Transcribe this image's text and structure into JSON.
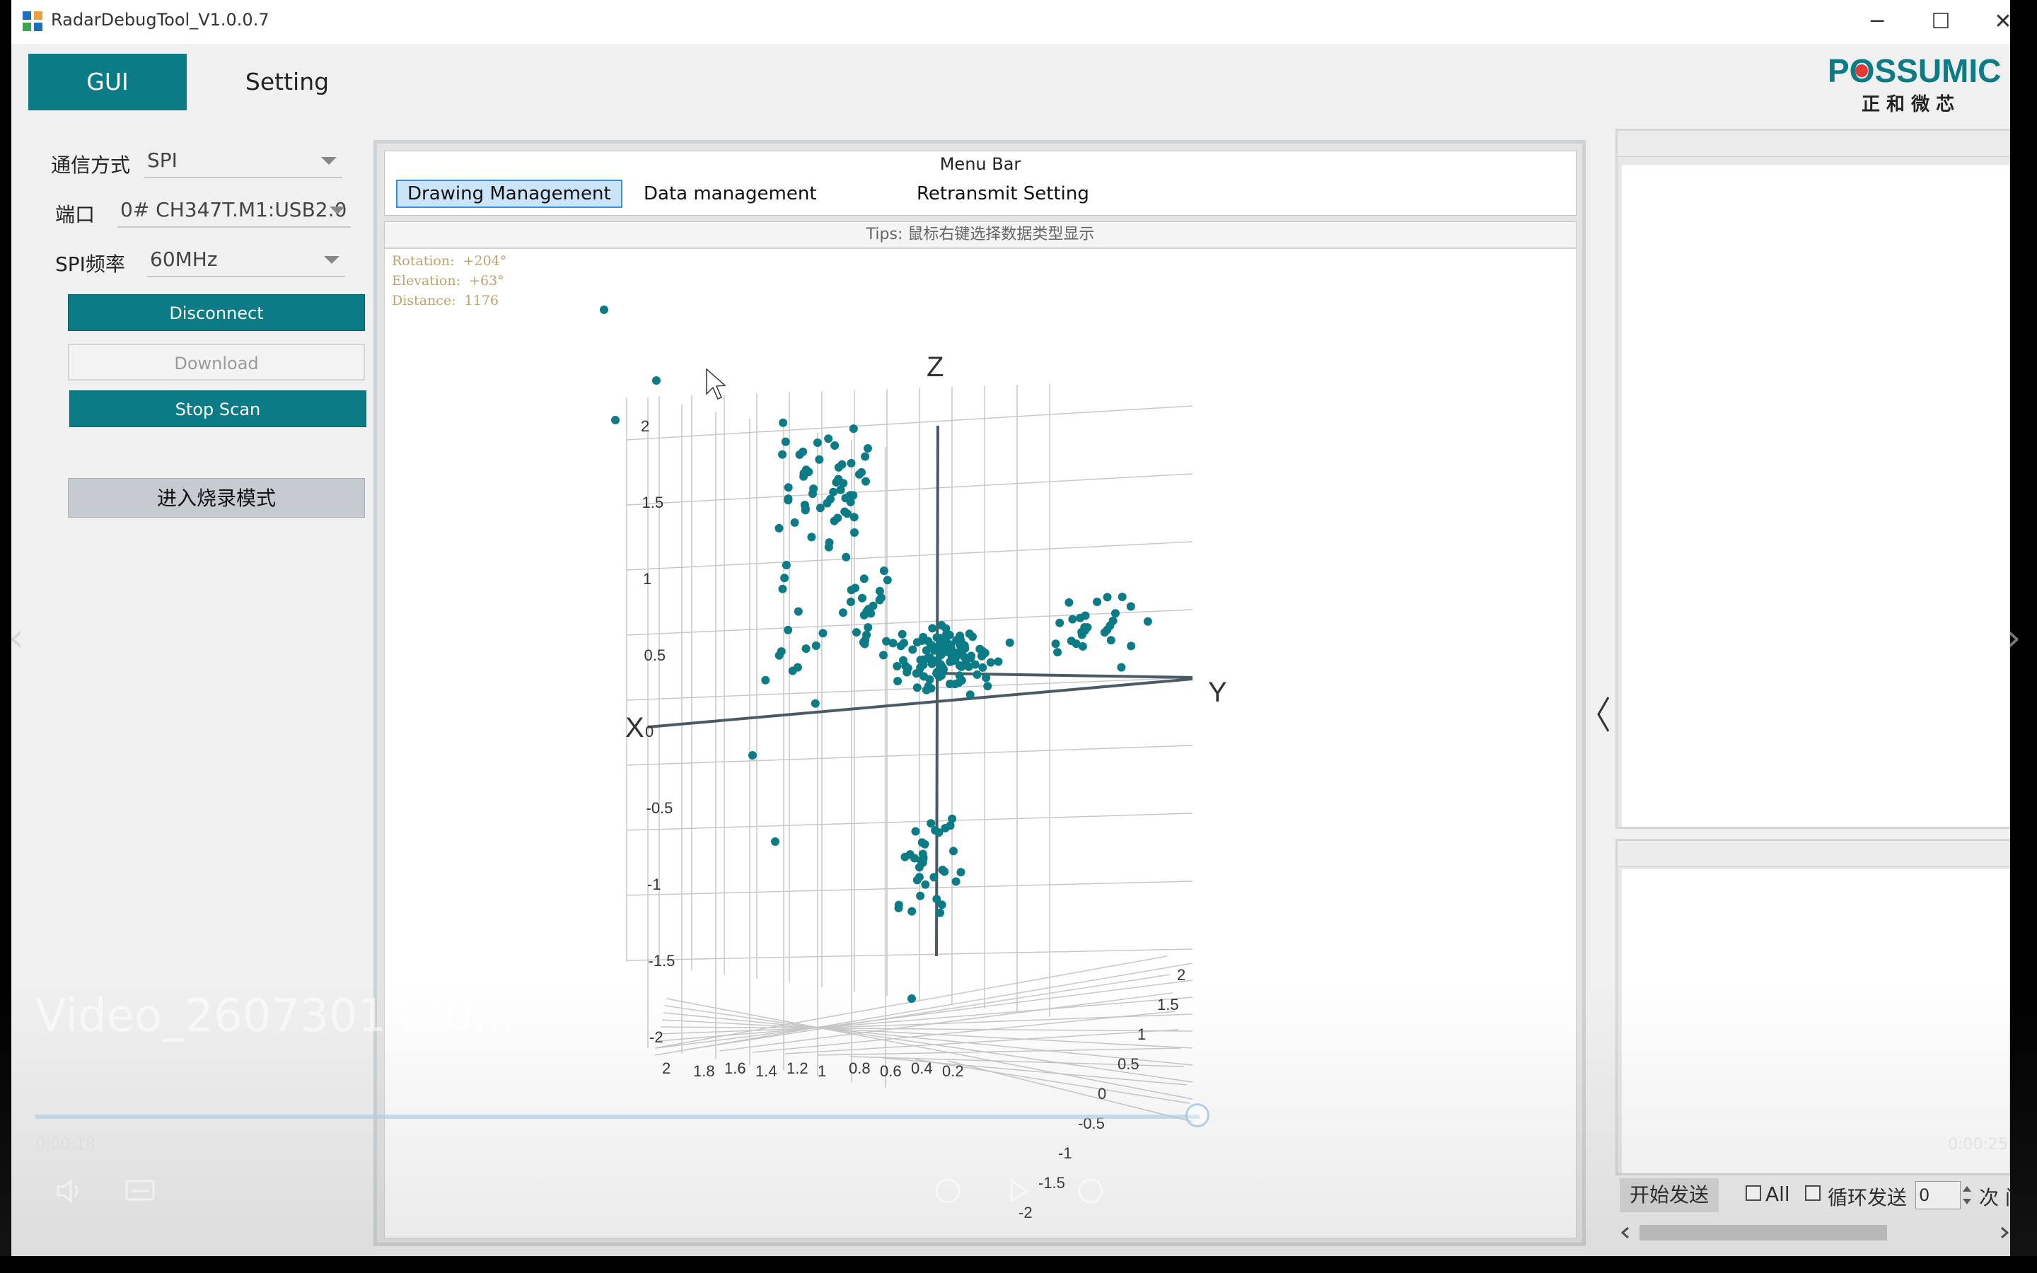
{
  "window": {
    "title": "RadarDebugTool_V1.0.0.7",
    "controls": {
      "minimize": "─",
      "maximize": "☐",
      "close": "✕"
    }
  },
  "top_tabs": {
    "gui": "GUI",
    "setting": "Setting"
  },
  "logo": {
    "brand": "POSSUMIC",
    "subtitle": "正 和 微 芯",
    "color": "#0b7b86"
  },
  "left": {
    "comm_label": "通信方式",
    "comm_value": "SPI",
    "port_label": "端口",
    "port_value": "0# CH347T.M1:USB2.0",
    "freq_label": "SPI频率",
    "freq_value": "60MHz",
    "disconnect": "Disconnect",
    "download": "Download",
    "stop_scan": "Stop Scan",
    "burn_mode": "进入烧录模式"
  },
  "center": {
    "menubar_title": "Menu Bar",
    "menu_items": [
      "Drawing Management",
      "Data management",
      "Retransmit Setting"
    ],
    "tips": "Tips: 鼠标右键选择数据类型显示",
    "info": {
      "rotation": "Rotation:  +204°",
      "elevation": "Elevation:  +63°",
      "distance": "Distance:  1176"
    }
  },
  "chart_data": {
    "type": "scatter",
    "title": "",
    "axis_names": {
      "x": "X",
      "y": "Y",
      "z": "Z"
    },
    "z_ticks": [
      "2",
      "1.5",
      "1",
      "0.5",
      "0",
      "-0.5",
      "-1",
      "-1.5",
      "-2"
    ],
    "x_ticks": [
      "2",
      "1.8",
      "1.6",
      "1.4",
      "1.2",
      "1",
      "0.8",
      "0.6",
      "0.4",
      "0.2"
    ],
    "y_ticks": [
      "2",
      "1.5",
      "1",
      "0.5",
      "0",
      "-0.5",
      "-1",
      "-1.5",
      "-2"
    ],
    "z_range": [
      -2,
      2
    ],
    "x_range": [
      0,
      2
    ],
    "y_range": [
      -2,
      2
    ],
    "grid": true,
    "point_color": "#0b7b86",
    "view": {
      "rotation_deg": 204,
      "elevation_deg": 63
    },
    "note": "approx. 300 radar point-cloud points, densest near origin"
  },
  "right": {
    "send": "开始发送",
    "all": "All",
    "loop_send": "循环发送",
    "count": "0",
    "times": "次 间"
  },
  "video": {
    "title": "Video_2607301420...",
    "time_left": "0:00:18",
    "time_right": "0:00:25"
  },
  "colors": {
    "accent": "#0b7b86",
    "selected_menu": "#cce4f7"
  }
}
